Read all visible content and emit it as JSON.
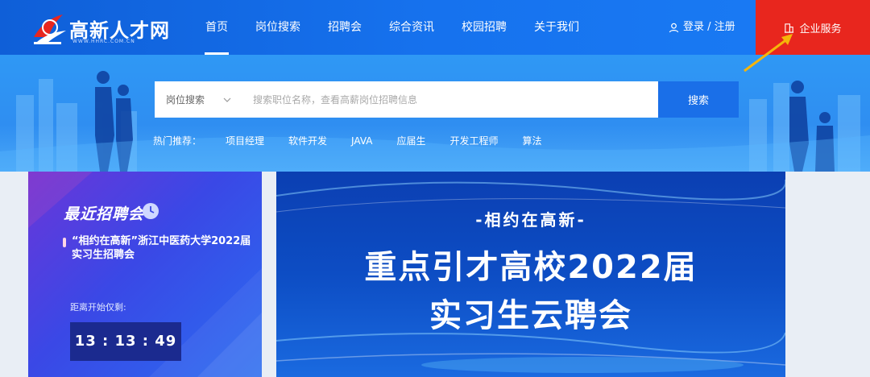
{
  "header": {
    "logo_text": "高新人才网",
    "logo_sub": "WWW.HHRC.COM.CN",
    "nav": [
      {
        "label": "首页",
        "active": true
      },
      {
        "label": "岗位搜索"
      },
      {
        "label": "招聘会"
      },
      {
        "label": "综合资讯"
      },
      {
        "label": "校园招聘"
      },
      {
        "label": "关于我们"
      }
    ],
    "login_label": "登录 / 注册",
    "enterprise_label": "企业服务"
  },
  "search": {
    "type_label": "岗位搜索",
    "placeholder": "搜索职位名称，查看高薪岗位招聘信息",
    "button_label": "搜索",
    "hot_label": "热门推荐：",
    "hot_items": [
      "项目经理",
      "软件开发",
      "JAVA",
      "应届生",
      "开发工程师",
      "算法"
    ]
  },
  "recent": {
    "title": "最近招聘会",
    "fair_name": "“相约在高新”浙江中医药大学2022届实习生招聘会",
    "countdown_label": "距离开始仅剩:",
    "countdown": "13 : 13 : 49"
  },
  "banner": {
    "subtitle": "-相约在高新-",
    "title_line1": "重点引才高校2022届",
    "title_line2": "实习生云聘会"
  },
  "colors": {
    "header_blue": "#1672ee",
    "enterprise_red": "#e8261e",
    "search_button": "#1a6fe8",
    "annotation_arrow": "#f5b50a"
  }
}
